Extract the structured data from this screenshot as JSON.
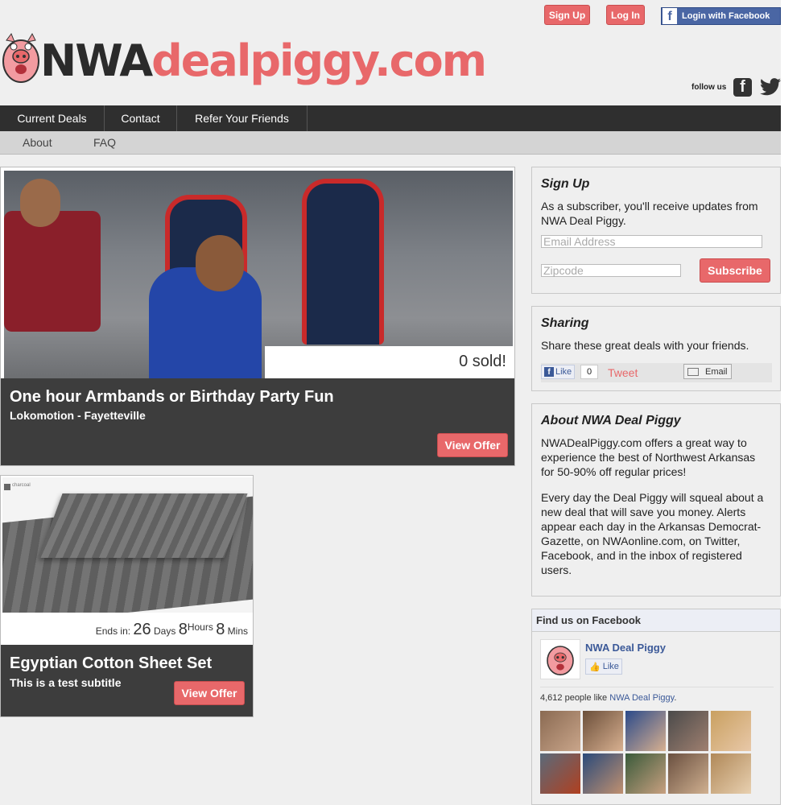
{
  "header": {
    "signup_label": "Sign Up",
    "login_label": "Log In",
    "fb_login_label": "Login with Facebook",
    "logo_nwa": "NWA",
    "logo_rest": "dealpiggy.com",
    "follow_label": "follow us"
  },
  "nav": {
    "items": [
      {
        "label": "Current Deals"
      },
      {
        "label": "Contact"
      },
      {
        "label": "Refer Your Friends"
      }
    ],
    "sub_items": [
      {
        "label": "About"
      },
      {
        "label": "FAQ"
      }
    ]
  },
  "deals": [
    {
      "sold": "0 sold!",
      "title": "One hour Armbands or Birthday Party Fun",
      "subtitle": "Lokomotion - Fayetteville",
      "button": "View Offer"
    },
    {
      "swatch_label": "charcoal",
      "ends_label": "Ends in:",
      "days": "26",
      "days_label": "Days",
      "hours": "8",
      "hours_label": "Hours",
      "mins": "8",
      "mins_label": "Mins",
      "title": "Egyptian Cotton Sheet Set",
      "subtitle": "This is a test subtitle",
      "button": "View Offer"
    }
  ],
  "sidebar": {
    "signup": {
      "title": "Sign Up",
      "text": "As a subscriber, you'll receive updates from NWA Deal Piggy.",
      "email_placeholder": "Email Address",
      "zip_placeholder": "Zipcode",
      "button": "Subscribe"
    },
    "sharing": {
      "title": "Sharing",
      "text": "Share these great deals with your friends.",
      "like_label": "Like",
      "like_count": "0",
      "tweet_label": "Tweet",
      "email_label": "Email"
    },
    "about": {
      "title": "About NWA Deal Piggy",
      "p1": "NWADealPiggy.com offers a great way to experience the best of Northwest Arkansas for 50-90% off regular prices!",
      "p2": "Every day the Deal Piggy will squeal about a new deal that will save you money. Alerts appear each day in the Arkansas Democrat-Gazette, on NWAonline.com, on Twitter, Facebook, and in the inbox of registered users."
    },
    "facebook": {
      "heading": "Find us on Facebook",
      "page_name": "NWA Deal Piggy",
      "like_label": "Like",
      "count_text": "4,612 people like",
      "count_link": "NWA Deal Piggy",
      "count_suffix": "."
    }
  },
  "colors": {
    "accent": "#e8686a",
    "nav_bg": "#2f2f2f",
    "deal_bar": "#3d3d3d",
    "facebook": "#3b5998"
  },
  "icons": [
    "pig-mascot-icon",
    "facebook-icon",
    "twitter-icon",
    "email-icon",
    "like-thumb-icon"
  ]
}
